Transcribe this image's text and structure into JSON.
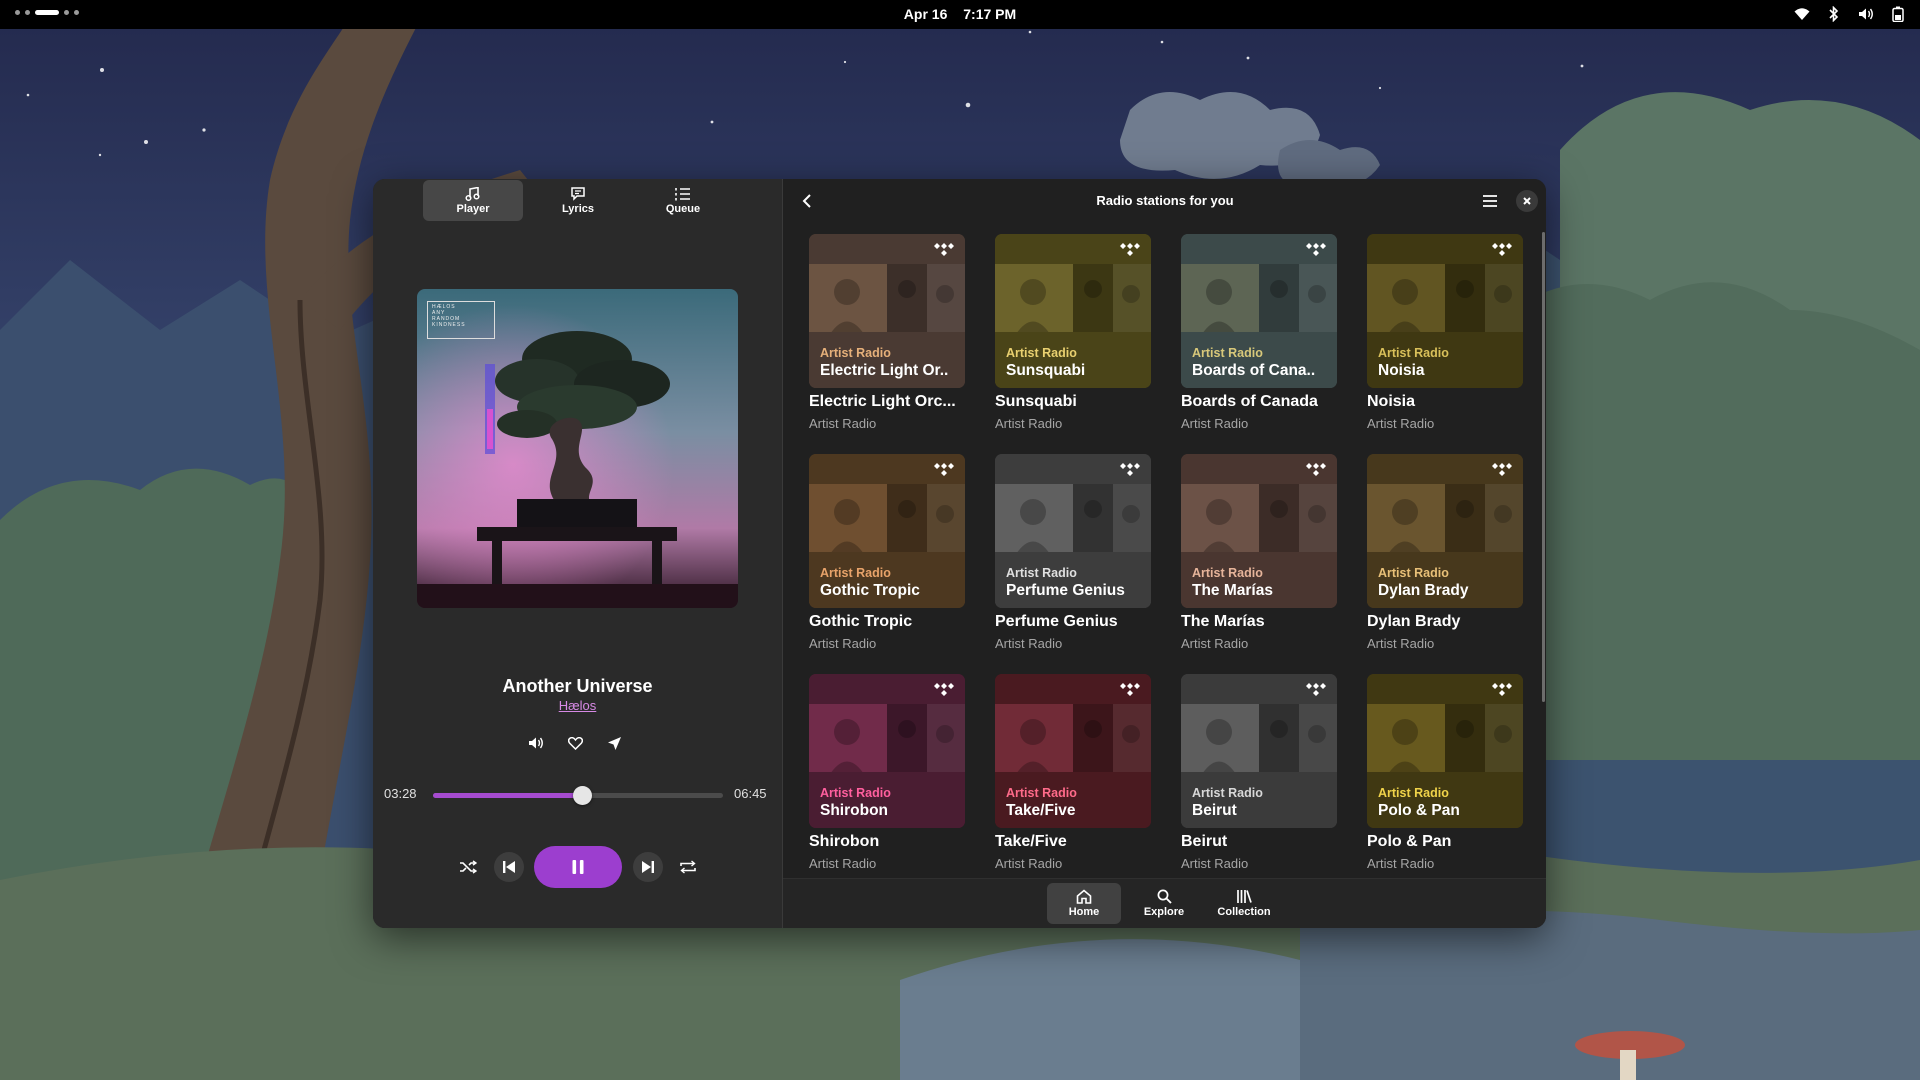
{
  "topbar": {
    "date": "Apr 16",
    "time": "7:17 PM",
    "workspaces": [
      false,
      false,
      true,
      false,
      false
    ],
    "tray": [
      "wifi-icon",
      "bluetooth-icon",
      "volume-icon",
      "battery-icon"
    ]
  },
  "player": {
    "tabs": [
      {
        "label": "Player",
        "icon": "music-note-icon",
        "active": true
      },
      {
        "label": "Lyrics",
        "icon": "chat-bubble-icon",
        "active": false
      },
      {
        "label": "Queue",
        "icon": "list-icon",
        "active": false
      }
    ],
    "track_title": "Another Universe",
    "artist": "Hælos",
    "current_time": "03:28",
    "total_time": "06:45",
    "progress": 0.513,
    "album_cover_text": [
      "HÆLOS",
      "ANY",
      "RANDOM",
      "KINDNESS"
    ],
    "accent_color": "#9c3ecf"
  },
  "browse": {
    "title": "Radio stations for you",
    "cards": [
      {
        "badge": "Artist Radio",
        "overlay": "Electric Light Or..",
        "title": "Electric Light Orc...",
        "subtitle": "Artist Radio",
        "tint": "#4a3a33",
        "label_color": "#e6b07a"
      },
      {
        "badge": "Artist Radio",
        "overlay": "Sunsquabi",
        "title": "Sunsquabi",
        "subtitle": "Artist Radio",
        "tint": "#4a4418",
        "label_color": "#e9d070"
      },
      {
        "badge": "Artist Radio",
        "overlay": "Boards of Cana..",
        "title": "Boards of Canada",
        "subtitle": "Artist Radio",
        "tint": "#3c4a4a",
        "label_color": "#d8c87a"
      },
      {
        "badge": "Artist Radio",
        "overlay": "Noisia",
        "title": "Noisia",
        "subtitle": "Artist Radio",
        "tint": "#3f3812",
        "label_color": "#d9c05a"
      },
      {
        "badge": "Artist Radio",
        "overlay": "Gothic Tropic",
        "title": "Gothic Tropic",
        "subtitle": "Artist Radio",
        "tint": "#4d3820",
        "label_color": "#e8a36a"
      },
      {
        "badge": "Artist Radio",
        "overlay": "Perfume Genius",
        "title": "Perfume Genius",
        "subtitle": "Artist Radio",
        "tint": "#3d3d3d",
        "label_color": "#e0e0e0"
      },
      {
        "badge": "Artist Radio",
        "overlay": "The Marías",
        "title": "The Marías",
        "subtitle": "Artist Radio",
        "tint": "#4a3630",
        "label_color": "#e6b49a"
      },
      {
        "badge": "Artist Radio",
        "overlay": "Dylan Brady",
        "title": "Dylan Brady",
        "subtitle": "Artist Radio",
        "tint": "#47381c",
        "label_color": "#e8c078"
      },
      {
        "badge": "Artist Radio",
        "overlay": "Shirobon",
        "title": "Shirobon",
        "subtitle": "Artist Radio",
        "tint": "#4a1d32",
        "label_color": "#ff5f9e"
      },
      {
        "badge": "Artist Radio",
        "overlay": "Take/Five",
        "title": "Take/Five",
        "subtitle": "Artist Radio",
        "tint": "#4a1a20",
        "label_color": "#ff6b8a"
      },
      {
        "badge": "Artist Radio",
        "overlay": "Beirut",
        "title": "Beirut",
        "subtitle": "Artist Radio",
        "tint": "#3b3b3b",
        "label_color": "#d8d8d8"
      },
      {
        "badge": "Artist Radio",
        "overlay": "Polo & Pan",
        "title": "Polo & Pan",
        "subtitle": "Artist Radio",
        "tint": "#403812",
        "label_color": "#f0d34a"
      }
    ]
  },
  "nav": [
    {
      "label": "Home",
      "icon": "home-icon",
      "active": true
    },
    {
      "label": "Explore",
      "icon": "search-icon",
      "active": false
    },
    {
      "label": "Collection",
      "icon": "library-icon",
      "active": false
    }
  ]
}
